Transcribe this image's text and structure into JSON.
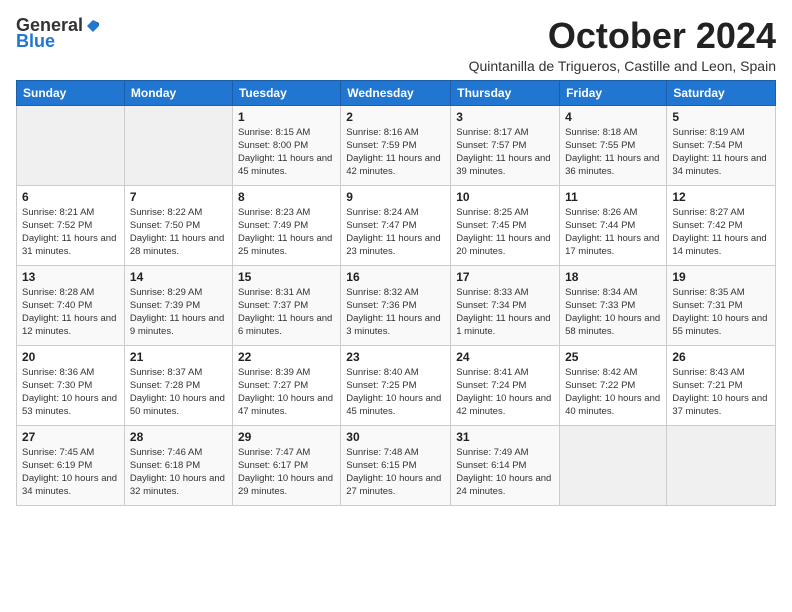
{
  "logo": {
    "general": "General",
    "blue": "Blue"
  },
  "title": "October 2024",
  "location": "Quintanilla de Trigueros, Castille and Leon, Spain",
  "days_of_week": [
    "Sunday",
    "Monday",
    "Tuesday",
    "Wednesday",
    "Thursday",
    "Friday",
    "Saturday"
  ],
  "weeks": [
    [
      {
        "day": "",
        "info": ""
      },
      {
        "day": "",
        "info": ""
      },
      {
        "day": "1",
        "info": "Sunrise: 8:15 AM\nSunset: 8:00 PM\nDaylight: 11 hours and 45 minutes."
      },
      {
        "day": "2",
        "info": "Sunrise: 8:16 AM\nSunset: 7:59 PM\nDaylight: 11 hours and 42 minutes."
      },
      {
        "day": "3",
        "info": "Sunrise: 8:17 AM\nSunset: 7:57 PM\nDaylight: 11 hours and 39 minutes."
      },
      {
        "day": "4",
        "info": "Sunrise: 8:18 AM\nSunset: 7:55 PM\nDaylight: 11 hours and 36 minutes."
      },
      {
        "day": "5",
        "info": "Sunrise: 8:19 AM\nSunset: 7:54 PM\nDaylight: 11 hours and 34 minutes."
      }
    ],
    [
      {
        "day": "6",
        "info": "Sunrise: 8:21 AM\nSunset: 7:52 PM\nDaylight: 11 hours and 31 minutes."
      },
      {
        "day": "7",
        "info": "Sunrise: 8:22 AM\nSunset: 7:50 PM\nDaylight: 11 hours and 28 minutes."
      },
      {
        "day": "8",
        "info": "Sunrise: 8:23 AM\nSunset: 7:49 PM\nDaylight: 11 hours and 25 minutes."
      },
      {
        "day": "9",
        "info": "Sunrise: 8:24 AM\nSunset: 7:47 PM\nDaylight: 11 hours and 23 minutes."
      },
      {
        "day": "10",
        "info": "Sunrise: 8:25 AM\nSunset: 7:45 PM\nDaylight: 11 hours and 20 minutes."
      },
      {
        "day": "11",
        "info": "Sunrise: 8:26 AM\nSunset: 7:44 PM\nDaylight: 11 hours and 17 minutes."
      },
      {
        "day": "12",
        "info": "Sunrise: 8:27 AM\nSunset: 7:42 PM\nDaylight: 11 hours and 14 minutes."
      }
    ],
    [
      {
        "day": "13",
        "info": "Sunrise: 8:28 AM\nSunset: 7:40 PM\nDaylight: 11 hours and 12 minutes."
      },
      {
        "day": "14",
        "info": "Sunrise: 8:29 AM\nSunset: 7:39 PM\nDaylight: 11 hours and 9 minutes."
      },
      {
        "day": "15",
        "info": "Sunrise: 8:31 AM\nSunset: 7:37 PM\nDaylight: 11 hours and 6 minutes."
      },
      {
        "day": "16",
        "info": "Sunrise: 8:32 AM\nSunset: 7:36 PM\nDaylight: 11 hours and 3 minutes."
      },
      {
        "day": "17",
        "info": "Sunrise: 8:33 AM\nSunset: 7:34 PM\nDaylight: 11 hours and 1 minute."
      },
      {
        "day": "18",
        "info": "Sunrise: 8:34 AM\nSunset: 7:33 PM\nDaylight: 10 hours and 58 minutes."
      },
      {
        "day": "19",
        "info": "Sunrise: 8:35 AM\nSunset: 7:31 PM\nDaylight: 10 hours and 55 minutes."
      }
    ],
    [
      {
        "day": "20",
        "info": "Sunrise: 8:36 AM\nSunset: 7:30 PM\nDaylight: 10 hours and 53 minutes."
      },
      {
        "day": "21",
        "info": "Sunrise: 8:37 AM\nSunset: 7:28 PM\nDaylight: 10 hours and 50 minutes."
      },
      {
        "day": "22",
        "info": "Sunrise: 8:39 AM\nSunset: 7:27 PM\nDaylight: 10 hours and 47 minutes."
      },
      {
        "day": "23",
        "info": "Sunrise: 8:40 AM\nSunset: 7:25 PM\nDaylight: 10 hours and 45 minutes."
      },
      {
        "day": "24",
        "info": "Sunrise: 8:41 AM\nSunset: 7:24 PM\nDaylight: 10 hours and 42 minutes."
      },
      {
        "day": "25",
        "info": "Sunrise: 8:42 AM\nSunset: 7:22 PM\nDaylight: 10 hours and 40 minutes."
      },
      {
        "day": "26",
        "info": "Sunrise: 8:43 AM\nSunset: 7:21 PM\nDaylight: 10 hours and 37 minutes."
      }
    ],
    [
      {
        "day": "27",
        "info": "Sunrise: 7:45 AM\nSunset: 6:19 PM\nDaylight: 10 hours and 34 minutes."
      },
      {
        "day": "28",
        "info": "Sunrise: 7:46 AM\nSunset: 6:18 PM\nDaylight: 10 hours and 32 minutes."
      },
      {
        "day": "29",
        "info": "Sunrise: 7:47 AM\nSunset: 6:17 PM\nDaylight: 10 hours and 29 minutes."
      },
      {
        "day": "30",
        "info": "Sunrise: 7:48 AM\nSunset: 6:15 PM\nDaylight: 10 hours and 27 minutes."
      },
      {
        "day": "31",
        "info": "Sunrise: 7:49 AM\nSunset: 6:14 PM\nDaylight: 10 hours and 24 minutes."
      },
      {
        "day": "",
        "info": ""
      },
      {
        "day": "",
        "info": ""
      }
    ]
  ]
}
